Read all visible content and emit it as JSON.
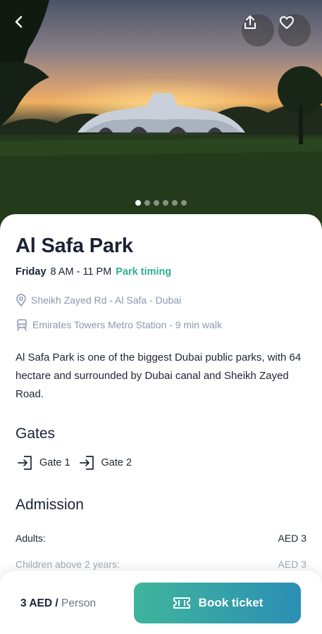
{
  "hero": {
    "image_label": "park-photo",
    "carousel_total": 6,
    "carousel_active_index": 0,
    "icons": {
      "back": "back-arrow-icon",
      "share": "share-icon",
      "favorite": "heart-icon"
    }
  },
  "park": {
    "title": "Al Safa Park",
    "day": "Friday",
    "hours": "8 AM - 11 PM",
    "timing_link": "Park timing",
    "address": "Sheikh Zayed Rd - Al Safa - Dubai",
    "metro": "Emirates Towers Metro Station - 9 min walk",
    "description": "Al Safa Park is one of the biggest Dubai public parks, with 64 hectare and surrounded by Dubai canal and Sheikh Zayed Road."
  },
  "gates": {
    "heading": "Gates",
    "items": [
      {
        "label": "Gate 1"
      },
      {
        "label": "Gate 2"
      }
    ]
  },
  "admission": {
    "heading": "Admission",
    "rows": [
      {
        "label": "Adults:",
        "value": "AED 3"
      },
      {
        "label": "Children above 2 years:",
        "value": "AED 3"
      }
    ]
  },
  "footer": {
    "price_amount": "3 AED /",
    "price_unit": "Person",
    "book_label": "Book ticket"
  },
  "colors": {
    "accent": "#2fae94",
    "button_start": "#3fb59c",
    "button_end": "#2b8fb4",
    "muted": "#8b97ad"
  }
}
